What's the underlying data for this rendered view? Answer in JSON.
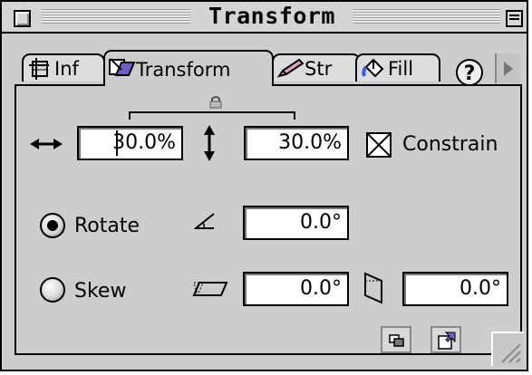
{
  "window": {
    "title": "Transform"
  },
  "tabs": [
    {
      "label": "Inf",
      "icon": "info-icon"
    },
    {
      "label": "Transform",
      "icon": "transform-icon",
      "active": true
    },
    {
      "label": "Str",
      "icon": "stroke-pencil-icon"
    },
    {
      "label": "Fill",
      "icon": "fill-bucket-icon"
    }
  ],
  "help": {
    "label": "?"
  },
  "scale": {
    "width": "30.0%",
    "height": "30.0%",
    "constrain_label": "Constrain",
    "constrain_checked": true
  },
  "rotate": {
    "label": "Rotate",
    "selected": true,
    "angle": "0.0°"
  },
  "skew": {
    "label": "Skew",
    "selected": false,
    "horizontal": "0.0°",
    "vertical": "0.0°"
  },
  "icons": {
    "width_arrow": "horizontal-double-arrow-icon",
    "height_arrow": "vertical-double-arrow-icon",
    "lock": "lock-icon",
    "rotate": "angle-icon",
    "skew_h": "skew-horizontal-icon",
    "skew_v": "skew-vertical-icon",
    "copy": "copy-transform-icon",
    "apply": "apply-transform-icon"
  }
}
